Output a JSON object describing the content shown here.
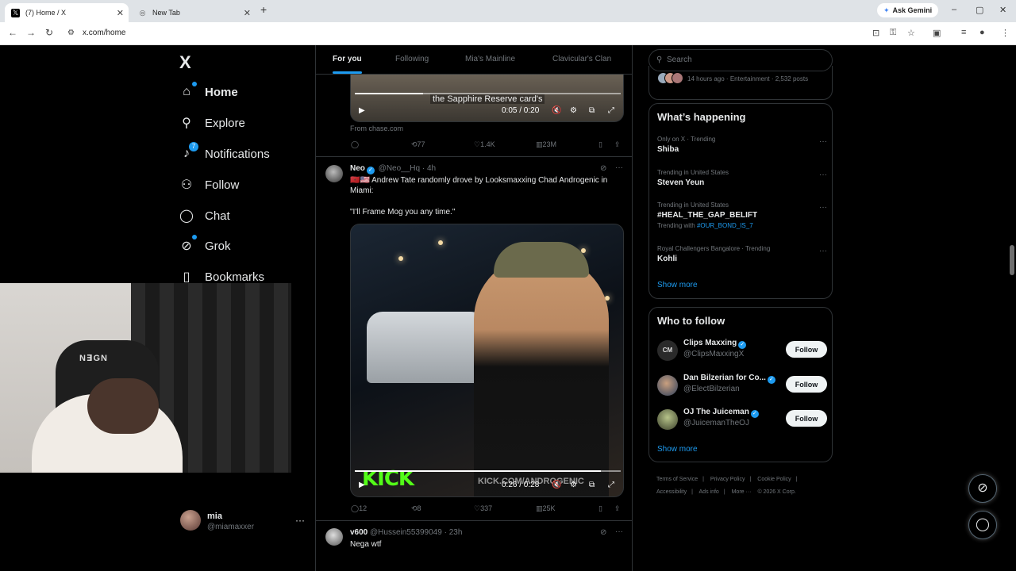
{
  "browser": {
    "tabs": [
      {
        "title": "(7) Home / X",
        "favicon": "x-logo-icon"
      },
      {
        "title": "New Tab",
        "favicon": "globe-icon"
      }
    ],
    "new_tab": "+",
    "gemini": "Ask Gemini",
    "url": "x.com/home",
    "window_controls": [
      "–",
      "▢",
      "✕"
    ]
  },
  "sidebar": {
    "logo": "X",
    "items": [
      {
        "label": "Home",
        "icon": "home-icon",
        "glyph": "⌂"
      },
      {
        "label": "Explore",
        "icon": "search-icon",
        "glyph": "⚲"
      },
      {
        "label": "Notifications",
        "icon": "bell-icon",
        "glyph": "♪",
        "badge": "7"
      },
      {
        "label": "Follow",
        "icon": "person-add-icon",
        "glyph": "⚇"
      },
      {
        "label": "Chat",
        "icon": "chat-icon",
        "glyph": "◯"
      },
      {
        "label": "Grok",
        "icon": "grok-icon",
        "glyph": "⊘"
      },
      {
        "label": "Bookmarks",
        "icon": "bookmark-icon",
        "glyph": "▯"
      }
    ],
    "account": {
      "name": "mia",
      "handle": "@miamaxxer",
      "more": "···"
    }
  },
  "webcam": {
    "chair_text": "N∃GN"
  },
  "feed": {
    "tabs": [
      "For you",
      "Following",
      "Mia's Mainline",
      "Clavicular's Clan"
    ],
    "post1": {
      "caption": "the Sapphire Reserve card's",
      "time": "0:05 / 0:20",
      "from": "From chase.com",
      "retweets": "77",
      "likes": "1.4K",
      "views": "23M"
    },
    "post2": {
      "name": "Neo",
      "handle": "@Neo__Hq",
      "time": "· 4h",
      "flags": "🇲🇦🇺🇸",
      "text": "Andrew Tate randomly drove by Looksmaxxing Chad Androgenic in Miami:",
      "quote": "\"I'll Frame Mog you any time.\"",
      "video_time": "0:26 / 0:28",
      "kick": "KICK",
      "kick_url": "KICK.COM/ANDROGENIC",
      "replies": "12",
      "retweets": "8",
      "likes": "337",
      "views": "25K"
    },
    "post3": {
      "name": "v600",
      "handle": "@Hussein55399049",
      "time": "· 23h",
      "text": "Nega wtf"
    }
  },
  "right": {
    "search_placeholder": "Search",
    "top_meta": "14 hours ago · Entertainment · 2,532 posts",
    "happening_title": "What’s happening",
    "trends": [
      {
        "meta": "Only on X · Trending",
        "title": "Shiba"
      },
      {
        "meta": "Trending in United States",
        "title": "Steven Yeun"
      },
      {
        "meta": "Trending in United States",
        "title": "#HEAL_THE_GAP_BELIFT",
        "with_label": "Trending with",
        "with_tag": "#OUR_BOND_IS_7"
      },
      {
        "meta": "Royal Challengers Bangalore · Trending",
        "title": "Kohli"
      }
    ],
    "show_more": "Show more",
    "who_title": "Who to follow",
    "who": [
      {
        "name": "Clips Maxxing",
        "handle": "@ClipsMaxxingX",
        "btn": "Follow"
      },
      {
        "name": "Dan Bilzerian for Co...",
        "handle": "@ElectBilzerian",
        "btn": "Follow"
      },
      {
        "name": "OJ The Juiceman",
        "handle": "@JuicemanTheOJ",
        "btn": "Follow"
      }
    ],
    "footer": [
      "Terms of Service",
      "|",
      "Privacy Policy",
      "|",
      "Cookie Policy",
      "|",
      "Accessibility",
      "|",
      "Ads info",
      "|",
      "More ···",
      "© 2026 X Corp."
    ]
  },
  "colors": {
    "accent": "#1d9bf0",
    "kick_green": "#53fc18"
  }
}
